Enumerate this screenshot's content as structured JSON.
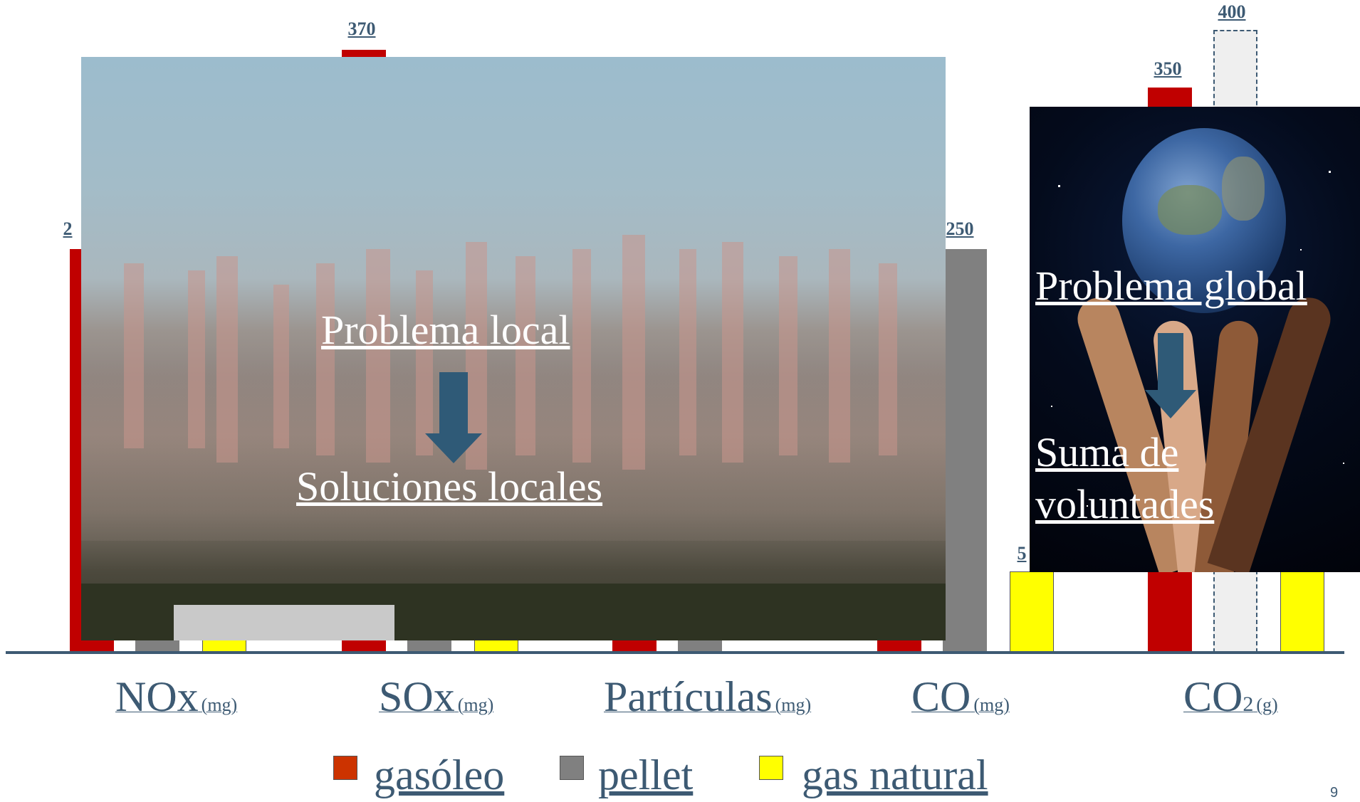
{
  "chart_data": {
    "type": "bar",
    "categories": [
      "NOx (mg)",
      "SOx (mg)",
      "Partículas (mg)",
      "CO (mg)",
      "CO2 (g)"
    ],
    "series": [
      {
        "name": "gasóleo",
        "color": "#c00000"
      },
      {
        "name": "pellet",
        "color": "#808080"
      },
      {
        "name": "gas natural",
        "color": "#ffff00"
      }
    ],
    "visible_value_labels": [
      "370",
      "250",
      "400",
      "350"
    ]
  },
  "labels": {
    "sox_gasoleo": "370",
    "co_pellet": "250",
    "co2_extra": "400",
    "co2_gasoleo": "350",
    "nox_partial": "2",
    "co_partial": "5"
  },
  "categories": {
    "nox": {
      "main": "NOx",
      "unit": "(mg)"
    },
    "sox": {
      "main": "SOx",
      "unit": "(mg)"
    },
    "part": {
      "main": "Partículas",
      "unit": "(mg)"
    },
    "co": {
      "main": "CO",
      "unit": "(mg)"
    },
    "co2": {
      "main": "CO",
      "sub": "2",
      "unit": "(g)"
    }
  },
  "legend": {
    "gasoleo": "gasóleo",
    "pellet": "pellet",
    "gas_natural": "gas natural",
    "colors": {
      "gasoleo": "#cc3300",
      "pellet": "#808080",
      "gas_natural": "#ffff00"
    }
  },
  "overlay_local": {
    "line1": "Problema local",
    "line2": "Soluciones locales"
  },
  "overlay_global": {
    "line1": "Problema global",
    "line2": "Suma de",
    "line3": "voluntades"
  },
  "slide_number": "9"
}
